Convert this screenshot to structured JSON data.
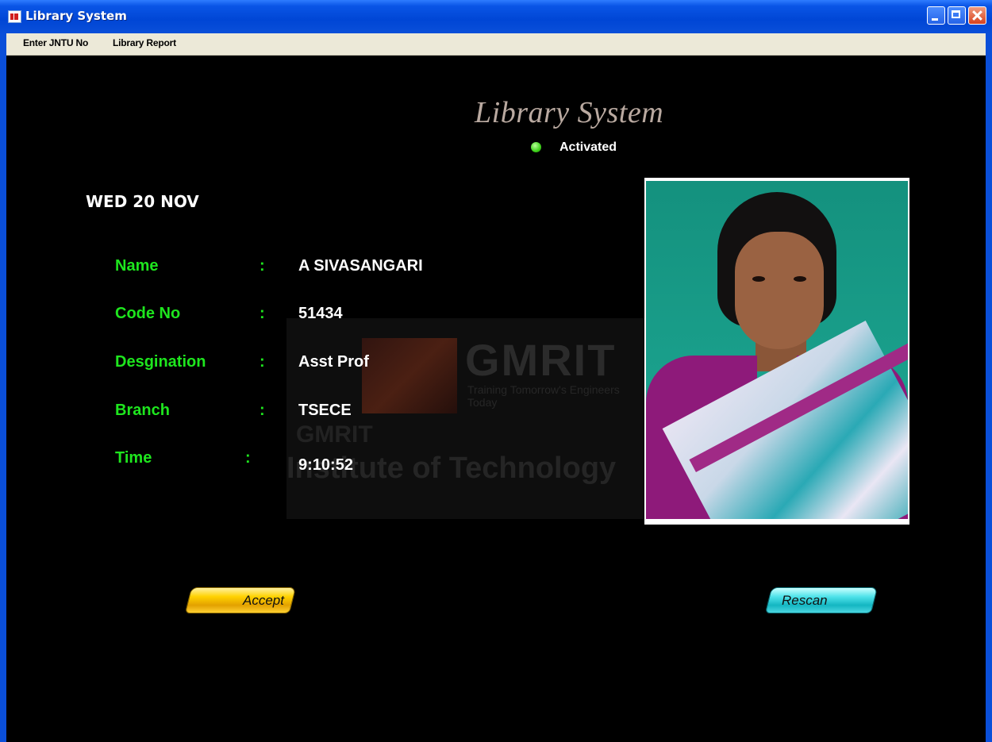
{
  "window": {
    "title": "Library System"
  },
  "menu": {
    "items": [
      "Enter JNTU No",
      "Library Report"
    ]
  },
  "header": {
    "title": "Library System",
    "status": "Activated",
    "status_color": "#3ed11a"
  },
  "date": "WED 20 NOV",
  "fields": [
    {
      "label": "Name",
      "separator": ":",
      "value": "A SIVASANGARI"
    },
    {
      "label": "Code No",
      "separator": ":",
      "value": "51434"
    },
    {
      "label": "Desgination",
      "separator": ":",
      "value": "Asst Prof"
    },
    {
      "label": "Branch",
      "separator": ":",
      "value": "TSECE"
    },
    {
      "label": "Time",
      "separator": ":",
      "value": "9:10:52"
    }
  ],
  "watermark": {
    "brand": "GMRIT",
    "tagline": "Training Tomorrow's Engineers Today",
    "line1": "GMRIT",
    "line2": "Institute of Technology"
  },
  "buttons": {
    "accept": "Accept",
    "rescan": "Rescan"
  },
  "colors": {
    "label": "#1ee61e",
    "title_bar": "#0046d5",
    "accept": "#ffd200",
    "rescan": "#14b6c2"
  }
}
